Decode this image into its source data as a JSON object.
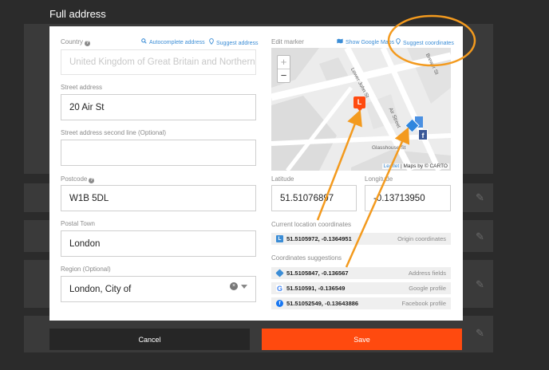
{
  "page": {
    "title": "Full address"
  },
  "form": {
    "country": {
      "label": "Country",
      "placeholder": "United Kingdom of Great Britain and Northern Ireland",
      "autocomplete_link": "Autocomplete address",
      "suggest_link": "Suggest address"
    },
    "street": {
      "label": "Street address",
      "value": "20 Air St"
    },
    "street2": {
      "label": "Street address second line (Optional)",
      "value": ""
    },
    "postcode": {
      "label": "Postcode",
      "value": "W1B 5DL"
    },
    "town": {
      "label": "Postal Town",
      "value": "London"
    },
    "region": {
      "label": "Region (Optional)",
      "value": "London, City of"
    }
  },
  "map": {
    "label": "Edit marker",
    "show_google_maps": "Show Google Maps",
    "suggest_coordinates": "Suggest coordinates",
    "zoom_in": "+",
    "zoom_out": "−",
    "attribution_leaflet": "Leaflet",
    "attribution_rest": "| Maps by © CARTO",
    "streets": [
      "Lower John St",
      "Air Street",
      "Glasshouse St",
      "Brewer St"
    ]
  },
  "coords": {
    "latitude_label": "Latitude",
    "latitude": "51.51076897",
    "longitude_label": "Longitude",
    "longitude": "-0.13713950"
  },
  "current_location": {
    "label": "Current location coordinates",
    "value": "51.5105972, -0.1364951",
    "source": "Origin coordinates",
    "icon_letter": "L"
  },
  "suggestions": {
    "label": "Coordinates suggestions",
    "items": [
      {
        "value": "51.5105847, -0.136567",
        "source": "Address fields",
        "icon": "diamond-arrow-icon",
        "color": "#3b8dd6"
      },
      {
        "value": "51.510591, -0.136549",
        "source": "Google profile",
        "icon": "google-icon",
        "color": "#4285f4"
      },
      {
        "value": "51.51052549, -0.13643886",
        "source": "Facebook profile",
        "icon": "facebook-icon",
        "color": "#1877f2"
      }
    ]
  },
  "buttons": {
    "cancel": "Cancel",
    "save": "Save"
  },
  "colors": {
    "accent_link": "#3b8dd6",
    "save": "#ff4a0f",
    "cancel": "#262626",
    "annotation": "#f39a1e",
    "marker": "#ff4a0f"
  }
}
